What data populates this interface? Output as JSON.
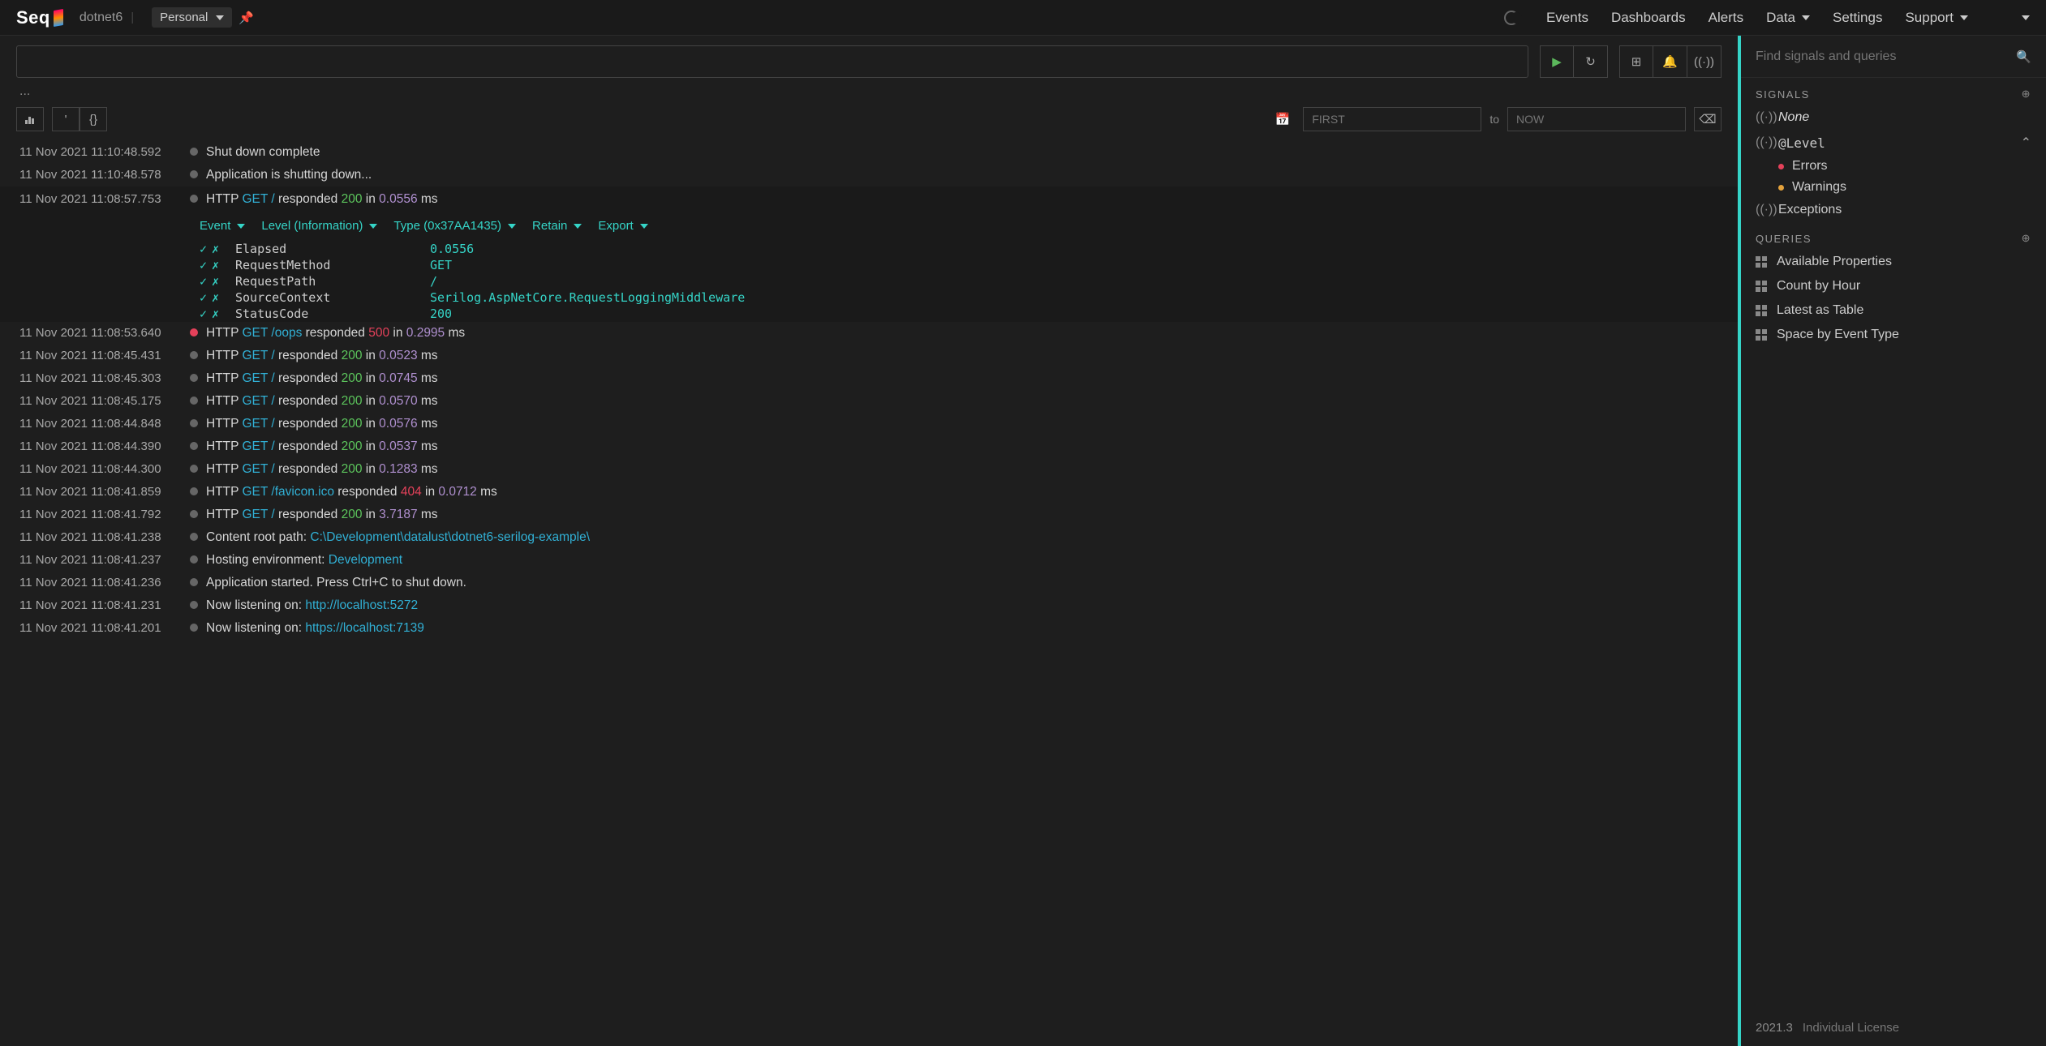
{
  "topbar": {
    "brand": "Seq",
    "project": "dotnet6",
    "workspace": "Personal",
    "nav": {
      "events": "Events",
      "dashboards": "Dashboards",
      "alerts": "Alerts",
      "data": "Data",
      "settings": "Settings",
      "support": "Support"
    }
  },
  "search": {
    "value": "",
    "ellipsis": "..."
  },
  "timebar": {
    "from_placeholder": "FIRST",
    "to_label": "to",
    "to_placeholder": "NOW"
  },
  "expanded_detail": {
    "menu": {
      "event": "Event",
      "level": "Level (Information)",
      "type": "Type (0x37AA1435)",
      "retain": "Retain",
      "export": "Export"
    },
    "props": [
      {
        "name": "Elapsed",
        "value": "0.0556"
      },
      {
        "name": "RequestMethod",
        "value": "GET"
      },
      {
        "name": "RequestPath",
        "value": "/"
      },
      {
        "name": "SourceContext",
        "value": "Serilog.AspNetCore.RequestLoggingMiddleware"
      },
      {
        "name": "StatusCode",
        "value": "200"
      }
    ]
  },
  "events": [
    {
      "ts": "11 Nov 2021 11:10:48.592",
      "level": "info",
      "kind": "plain",
      "text": "Shut down complete"
    },
    {
      "ts": "11 Nov 2021 11:10:48.578",
      "level": "info",
      "kind": "plain",
      "text": "Application is shutting down..."
    },
    {
      "ts": "11 Nov 2021 11:08:57.753",
      "level": "info",
      "kind": "http",
      "method": "GET",
      "path": "/",
      "status": "200",
      "statusClass": "ok",
      "elapsed": "0.0556",
      "expanded": true
    },
    {
      "ts": "11 Nov 2021 11:08:53.640",
      "level": "error",
      "kind": "http",
      "method": "GET",
      "path": "/oops",
      "status": "500",
      "statusClass": "err",
      "elapsed": "0.2995"
    },
    {
      "ts": "11 Nov 2021 11:08:45.431",
      "level": "info",
      "kind": "http",
      "method": "GET",
      "path": "/",
      "status": "200",
      "statusClass": "ok",
      "elapsed": "0.0523"
    },
    {
      "ts": "11 Nov 2021 11:08:45.303",
      "level": "info",
      "kind": "http",
      "method": "GET",
      "path": "/",
      "status": "200",
      "statusClass": "ok",
      "elapsed": "0.0745"
    },
    {
      "ts": "11 Nov 2021 11:08:45.175",
      "level": "info",
      "kind": "http",
      "method": "GET",
      "path": "/",
      "status": "200",
      "statusClass": "ok",
      "elapsed": "0.0570"
    },
    {
      "ts": "11 Nov 2021 11:08:44.848",
      "level": "info",
      "kind": "http",
      "method": "GET",
      "path": "/",
      "status": "200",
      "statusClass": "ok",
      "elapsed": "0.0576"
    },
    {
      "ts": "11 Nov 2021 11:08:44.390",
      "level": "info",
      "kind": "http",
      "method": "GET",
      "path": "/",
      "status": "200",
      "statusClass": "ok",
      "elapsed": "0.0537"
    },
    {
      "ts": "11 Nov 2021 11:08:44.300",
      "level": "info",
      "kind": "http",
      "method": "GET",
      "path": "/",
      "status": "200",
      "statusClass": "ok",
      "elapsed": "0.1283"
    },
    {
      "ts": "11 Nov 2021 11:08:41.859",
      "level": "info",
      "kind": "http",
      "method": "GET",
      "path": "/favicon.ico",
      "status": "404",
      "statusClass": "err",
      "elapsed": "0.0712"
    },
    {
      "ts": "11 Nov 2021 11:08:41.792",
      "level": "info",
      "kind": "http",
      "method": "GET",
      "path": "/",
      "status": "200",
      "statusClass": "ok",
      "elapsed": "3.7187"
    },
    {
      "ts": "11 Nov 2021 11:08:41.238",
      "level": "info",
      "kind": "kv",
      "text": "Content root path: ",
      "val": "C:\\Development\\datalust\\dotnet6-serilog-example\\"
    },
    {
      "ts": "11 Nov 2021 11:08:41.237",
      "level": "info",
      "kind": "kv",
      "text": "Hosting environment: ",
      "val": "Development"
    },
    {
      "ts": "11 Nov 2021 11:08:41.236",
      "level": "info",
      "kind": "plain",
      "text": "Application started. Press Ctrl+C to shut down."
    },
    {
      "ts": "11 Nov 2021 11:08:41.231",
      "level": "info",
      "kind": "kv",
      "text": "Now listening on: ",
      "val": "http://localhost:5272"
    },
    {
      "ts": "11 Nov 2021 11:08:41.201",
      "level": "info",
      "kind": "kv",
      "text": "Now listening on: ",
      "val": "https://localhost:7139"
    }
  ],
  "right": {
    "search_placeholder": "Find signals and queries",
    "signals_head": "SIGNALS",
    "signals": {
      "none": "None",
      "level": "@Level",
      "errors": "Errors",
      "warnings": "Warnings",
      "exceptions": "Exceptions"
    },
    "queries_head": "QUERIES",
    "queries": [
      "Available Properties",
      "Count by Hour",
      "Latest as Table",
      "Space by Event Type"
    ]
  },
  "footer": {
    "version": "2021.3",
    "license": "Individual License"
  }
}
